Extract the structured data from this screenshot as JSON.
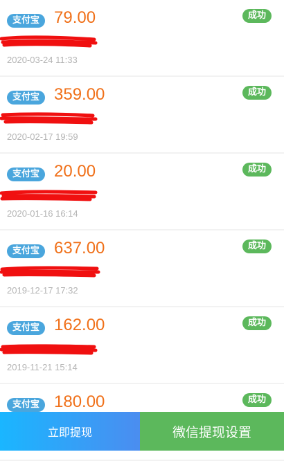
{
  "records": [
    {
      "method": "支付宝",
      "amount": "79.00",
      "status": "成功",
      "date": "2020-03-24 11:33"
    },
    {
      "method": "支付宝",
      "amount": "359.00",
      "status": "成功",
      "date": "2020-02-17 19:59"
    },
    {
      "method": "支付宝",
      "amount": "20.00",
      "status": "成功",
      "date": "2020-01-16 16:14"
    },
    {
      "method": "支付宝",
      "amount": "637.00",
      "status": "成功",
      "date": "2019-12-17 17:32"
    },
    {
      "method": "支付宝",
      "amount": "162.00",
      "status": "成功",
      "date": "2019-11-21 15:14"
    },
    {
      "method": "支付宝",
      "amount": "180.00",
      "status": "成功",
      "date": ""
    }
  ],
  "bottom_bar": {
    "withdraw_label": "立即提现",
    "wechat_settings_label": "微信提现设置"
  },
  "colors": {
    "amount": "#f07019",
    "alipay_tag": "#4aa6dd",
    "status_success": "#5cb85c",
    "redaction": "#f01010"
  }
}
